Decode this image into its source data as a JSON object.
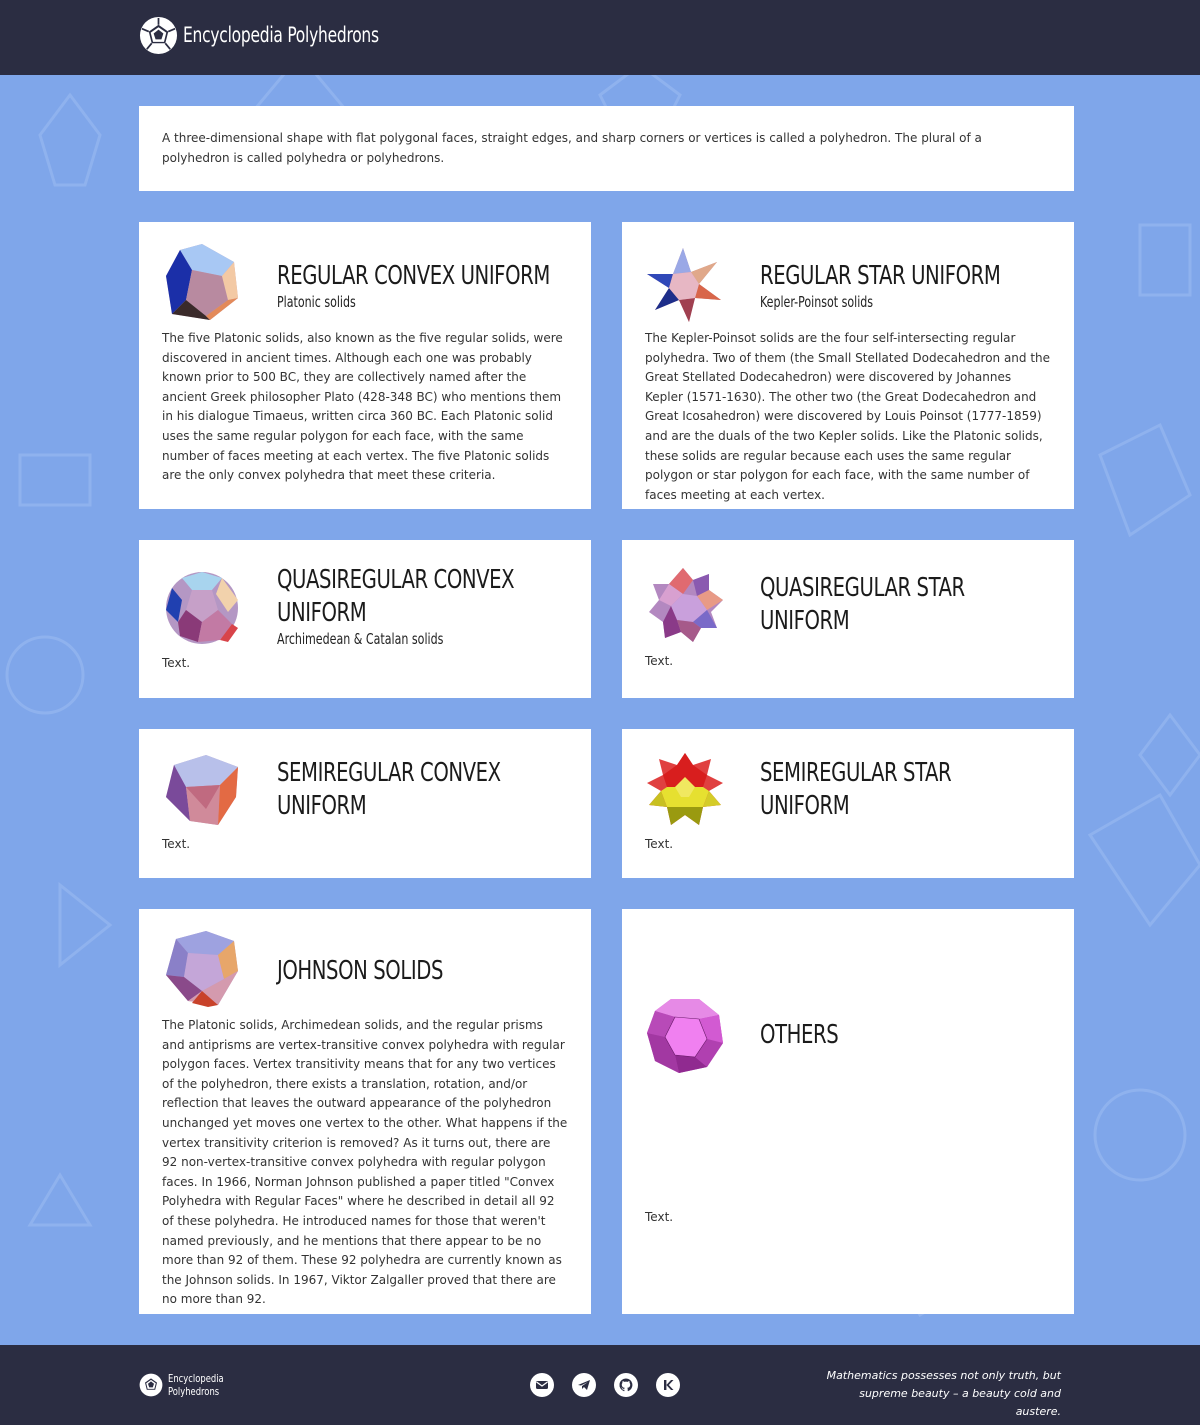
{
  "header": {
    "title": "Encyclopedia Polyhedrons",
    "logo_icon": "polyhedron-logo-icon"
  },
  "intro": {
    "text": "A three-dimensional shape with flat polygonal faces, straight edges, and sharp corners or vertices is called a polyhedron. The plural of a polyhedron is called polyhedra or polyhedrons."
  },
  "cards": [
    {
      "title": "REGULAR CONVEX UNIFORM",
      "subtitle": "Platonic solids",
      "icon": "dodecahedron-icon",
      "text": "The five Platonic solids, also known as the five regular solids, were discovered in ancient times. Although each one was probably known prior to 500 BC, they are collectively named after the ancient Greek philosopher Plato (428-348 BC) who mentions them in his dialogue Timaeus, written circa 360 BC. Each Platonic solid uses the same regular polygon for each face, with the same number of faces meeting at each vertex. The five Platonic solids are the only convex polyhedra that meet these criteria."
    },
    {
      "title": "REGULAR STAR UNIFORM",
      "subtitle": "Kepler-Poinsot solids",
      "icon": "stellated-dodecahedron-icon",
      "text": "The Kepler-Poinsot solids are the four self-intersecting regular polyhedra. Two of them (the Small Stellated Dodecahedron and the Great Stellated Dodecahedron) were discovered by Johannes Kepler (1571-1630). The other two (the Great Dodecahedron and Great Icosahedron) were discovered by Louis Poinsot (1777-1859) and are the duals of the two Kepler solids. Like the Platonic solids, these solids are regular because each uses the same regular polygon or star polygon for each face, with the same number of faces meeting at each vertex."
    },
    {
      "title_line1": "QUASIREGULAR CONVEX",
      "title_line2": "UNIFORM",
      "subtitle": "Archimedean & Catalan solids",
      "icon": "icosidodecahedron-icon",
      "text": "Text."
    },
    {
      "title_line1": "QUASIREGULAR STAR",
      "title_line2": "UNIFORM",
      "icon": "star-icosidodecahedron-icon",
      "text": "Text."
    },
    {
      "title_line1": "SEMIREGULAR CONVEX",
      "title_line2": "UNIFORM",
      "icon": "prism-icon",
      "text": "Text."
    },
    {
      "title_line1": "SEMIREGULAR STAR",
      "title_line2": "UNIFORM",
      "icon": "star-prism-icon",
      "text": "Text."
    },
    {
      "title": "JOHNSON SOLIDS",
      "icon": "johnson-solid-icon",
      "text": "The Platonic solids, Archimedean solids, and the regular prisms and antiprisms are vertex-transitive convex polyhedra with regular polygon faces. Vertex transitivity means that for any two vertices of the polyhedron, there exists a translation, rotation, and/or reflection that leaves the outward appearance of the polyhedron unchanged yet moves one vertex to the other. What happens if the vertex transitivity criterion is removed? As it turns out, there are 92 non-vertex-transitive convex polyhedra with regular polygon faces. In 1966, Norman Johnson published a paper titled \"Convex Polyhedra with Regular Faces\" where he described in detail all 92 of these polyhedra. He introduced names for those that weren't named previously, and he mentions that there appear to be no more than 92 of them. These 92 polyhedra are currently known as the Johnson solids. In 1967, Viktor Zalgaller proved that there are no more than 92."
    },
    {
      "title": "OTHERS",
      "icon": "rhombicuboctahedron-icon",
      "text": "Text."
    }
  ],
  "footer": {
    "brand_line1": "Encyclopedia",
    "brand_line2": "Polyhedrons",
    "socials": [
      {
        "name": "email-icon"
      },
      {
        "name": "telegram-icon"
      },
      {
        "name": "github-icon"
      },
      {
        "name": "kofi-icon"
      }
    ],
    "quote_line1": "Mathematics possesses not only truth, but",
    "quote_line2": "supreme beauty – a beauty cold and austere."
  },
  "colors": {
    "header_bg": "#2b2d42",
    "page_bg": "#7fa6ea",
    "card_bg": "#ffffff"
  }
}
